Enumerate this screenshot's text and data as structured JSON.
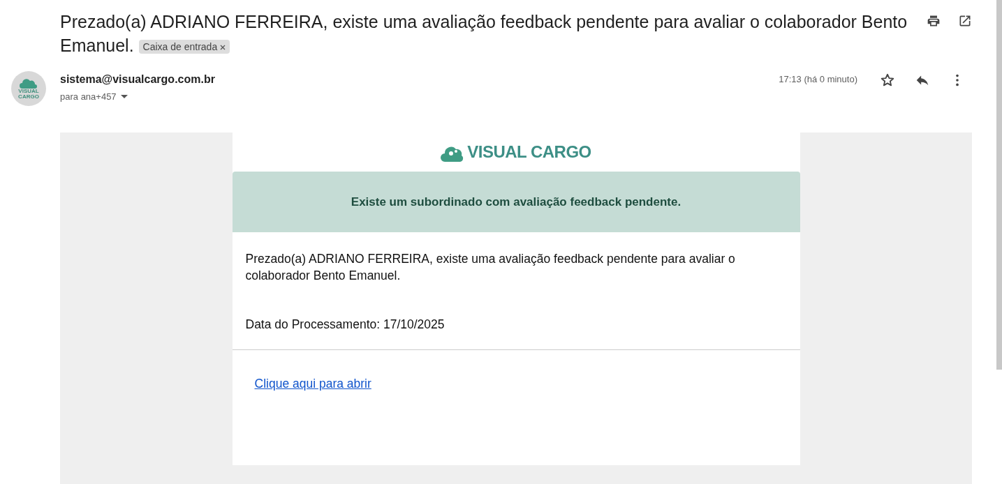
{
  "subject": {
    "text": "Prezado(a) ADRIANO FERREIRA, existe uma avaliação feedback pendente para avaliar o colaborador Bento Emanuel.",
    "label": "Caixa de entrada"
  },
  "sender": {
    "avatar_text": [
      "VISUAL",
      "CARGO"
    ],
    "email": "sistema@visualcargo.com.br",
    "recipients": "para ana+457",
    "time": "17:13 (há 0 minuto)",
    "starred": false
  },
  "body": {
    "logo_text": "VISUAL CARGO",
    "banner": "Existe um subordinado com avaliação feedback pendente.",
    "message": "Prezado(a) ADRIANO FERREIRA, existe uma avaliação feedback pendente para avaliar o colaborador Bento Emanuel.",
    "date_line": "Data do Processamento: 17/10/2025",
    "link": "Clique aqui para abrir"
  }
}
